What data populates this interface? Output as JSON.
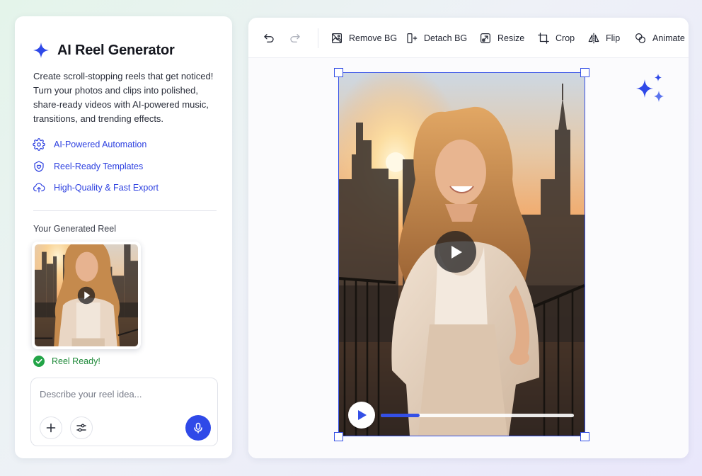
{
  "app": {
    "title": "AI Reel Generator",
    "accent_color": "#2f49e8",
    "logo_icon": "sparkle-icon"
  },
  "description_lines": [
    "Create scroll-stopping reels that get noticed!",
    "Turn your photos and clips into polished,",
    "share-ready videos with AI-powered music,",
    "transitions, and trending effects."
  ],
  "features": [
    {
      "label": "AI-Powered Automation",
      "icon": "gear-icon"
    },
    {
      "label": "Reel-Ready Templates",
      "icon": "heart-shield-icon"
    },
    {
      "label": "High-Quality & Fast Export",
      "icon": "cloud-upload-icon"
    }
  ],
  "generated": {
    "section_label": "Your Generated Reel",
    "status_label": "Reel Ready!",
    "status_color": "#22a447"
  },
  "prompt": {
    "placeholder": "Describe your reel idea...",
    "value": ""
  },
  "toolbar": {
    "undo_icon": "undo-icon",
    "redo_icon": "redo-icon",
    "tools": [
      {
        "label": "Remove BG",
        "icon": "remove-bg-icon"
      },
      {
        "label": "Detach BG",
        "icon": "detach-bg-icon"
      },
      {
        "label": "Resize",
        "icon": "resize-icon"
      },
      {
        "label": "Crop",
        "icon": "crop-icon"
      },
      {
        "label": "Flip",
        "icon": "flip-icon"
      },
      {
        "label": "Animate",
        "icon": "animate-icon"
      }
    ]
  },
  "player": {
    "progress_fraction": 0.2,
    "progress_color": "#3450e6"
  }
}
